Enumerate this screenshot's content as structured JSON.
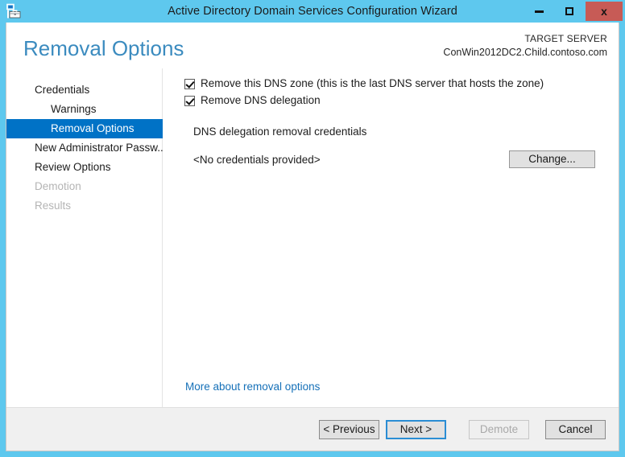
{
  "window": {
    "title": "Active Directory Domain Services Configuration Wizard",
    "icon": "server-wizard-icon",
    "controls": {
      "minimize": "minimize-icon",
      "maximize": "maximize-icon",
      "close": "x"
    },
    "titlebar_color": "#5EC8EE",
    "close_button_color": "#C75B56"
  },
  "header": {
    "page_title": "Removal Options",
    "target_label": "TARGET SERVER",
    "target_server": "ConWin2012DC2.Child.contoso.com",
    "title_color": "#3B8BBF"
  },
  "sidebar": {
    "selection_color": "#0072C6",
    "items": [
      {
        "label": "Credentials",
        "state": "normal",
        "indent": false
      },
      {
        "label": "Warnings",
        "state": "normal",
        "indent": true
      },
      {
        "label": "Removal Options",
        "state": "selected",
        "indent": true
      },
      {
        "label": "New Administrator Passw...",
        "state": "normal",
        "indent": false
      },
      {
        "label": "Review Options",
        "state": "normal",
        "indent": false
      },
      {
        "label": "Demotion",
        "state": "disabled",
        "indent": false
      },
      {
        "label": "Results",
        "state": "disabled",
        "indent": false
      }
    ]
  },
  "content": {
    "checkboxes": [
      {
        "label": "Remove this DNS zone (this is the last DNS server that hosts the zone)",
        "checked": true
      },
      {
        "label": "Remove DNS delegation",
        "checked": true
      }
    ],
    "credentials_heading": "DNS delegation removal credentials",
    "credentials_value": "<No credentials provided>",
    "change_button": "Change...",
    "more_link": "More about removal options",
    "link_color": "#1570B8"
  },
  "footer": {
    "previous_button": "< Previous",
    "next_button": "Next >",
    "demote_button": "Demote",
    "cancel_button": "Cancel",
    "default_button_outline": "#2A8DD4"
  }
}
